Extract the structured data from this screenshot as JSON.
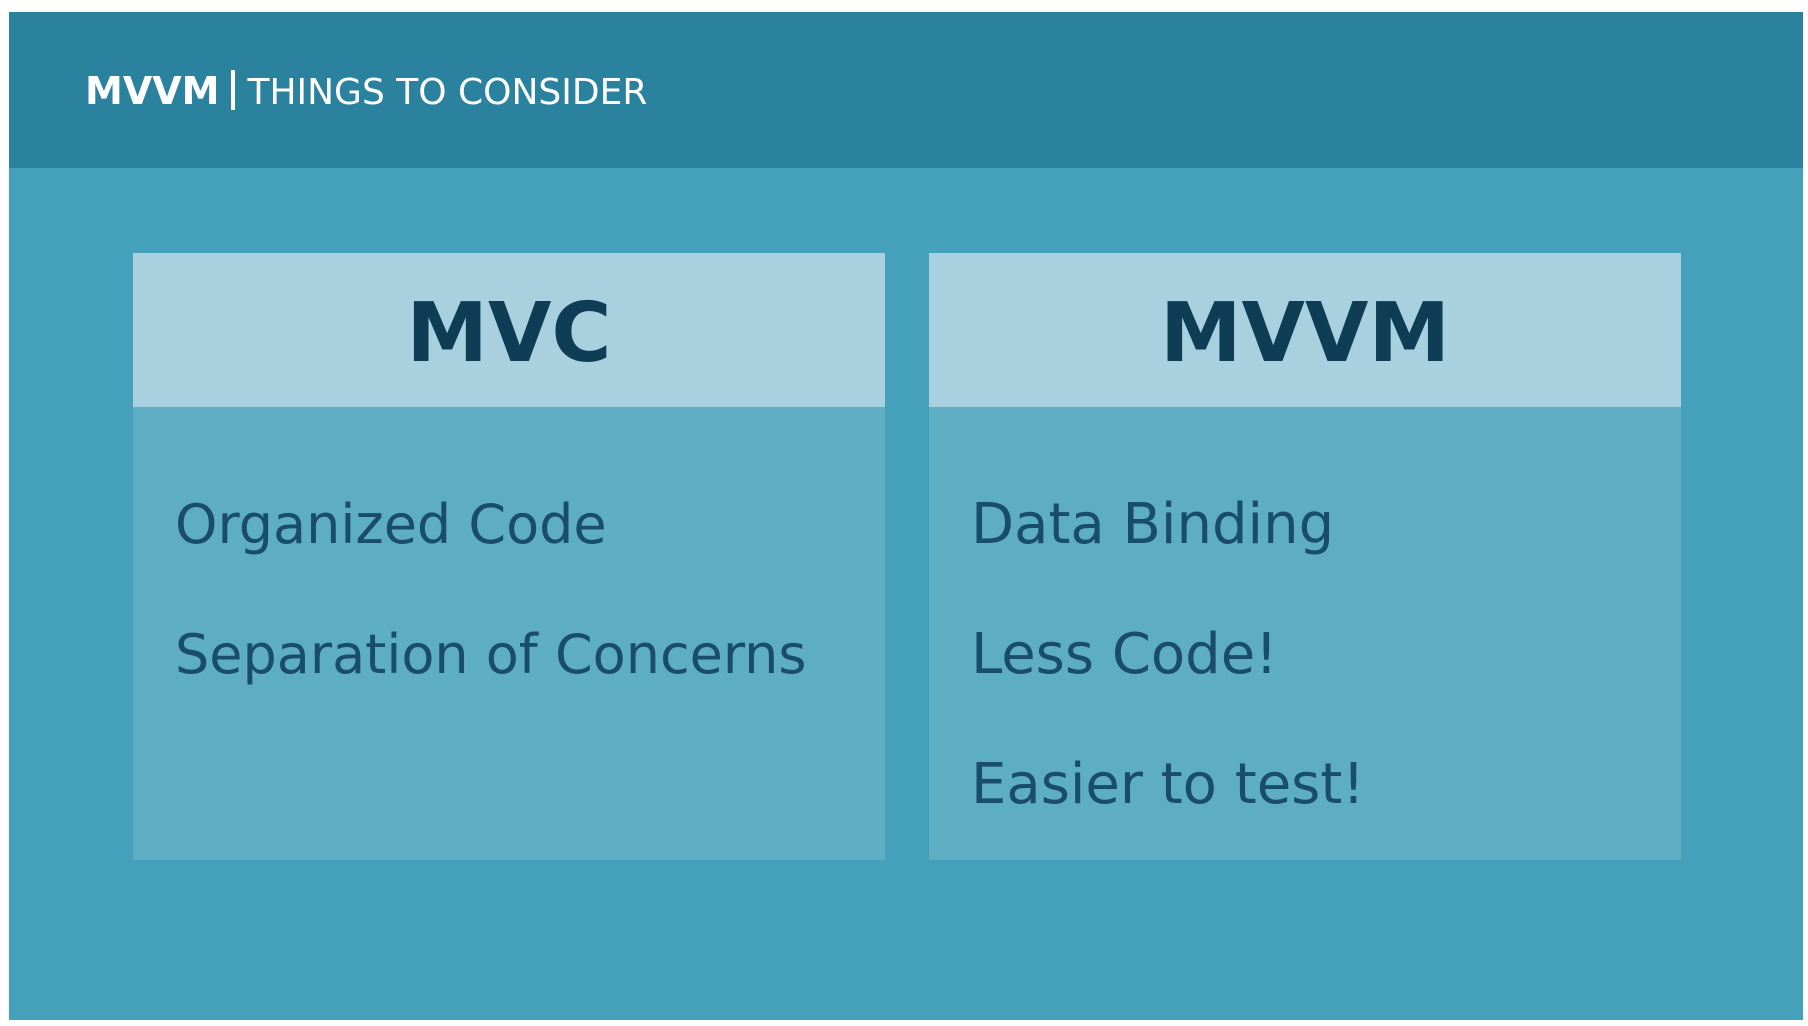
{
  "header": {
    "title_strong": "MVVM",
    "title_rest": "THINGS TO CONSIDER"
  },
  "cards": [
    {
      "title": "MVC",
      "items": [
        "Organized Code",
        "Separation of Concerns"
      ]
    },
    {
      "title": "MVVM",
      "items": [
        "Data Binding",
        "Less Code!",
        "Easier to test!"
      ]
    }
  ],
  "colors": {
    "background": "#44a0bb",
    "header": "#2a829f",
    "card_head": "#a9d0de",
    "card_body": "#5eaec3",
    "title_text": "#0e3d55",
    "item_text": "#1a4d6a"
  }
}
